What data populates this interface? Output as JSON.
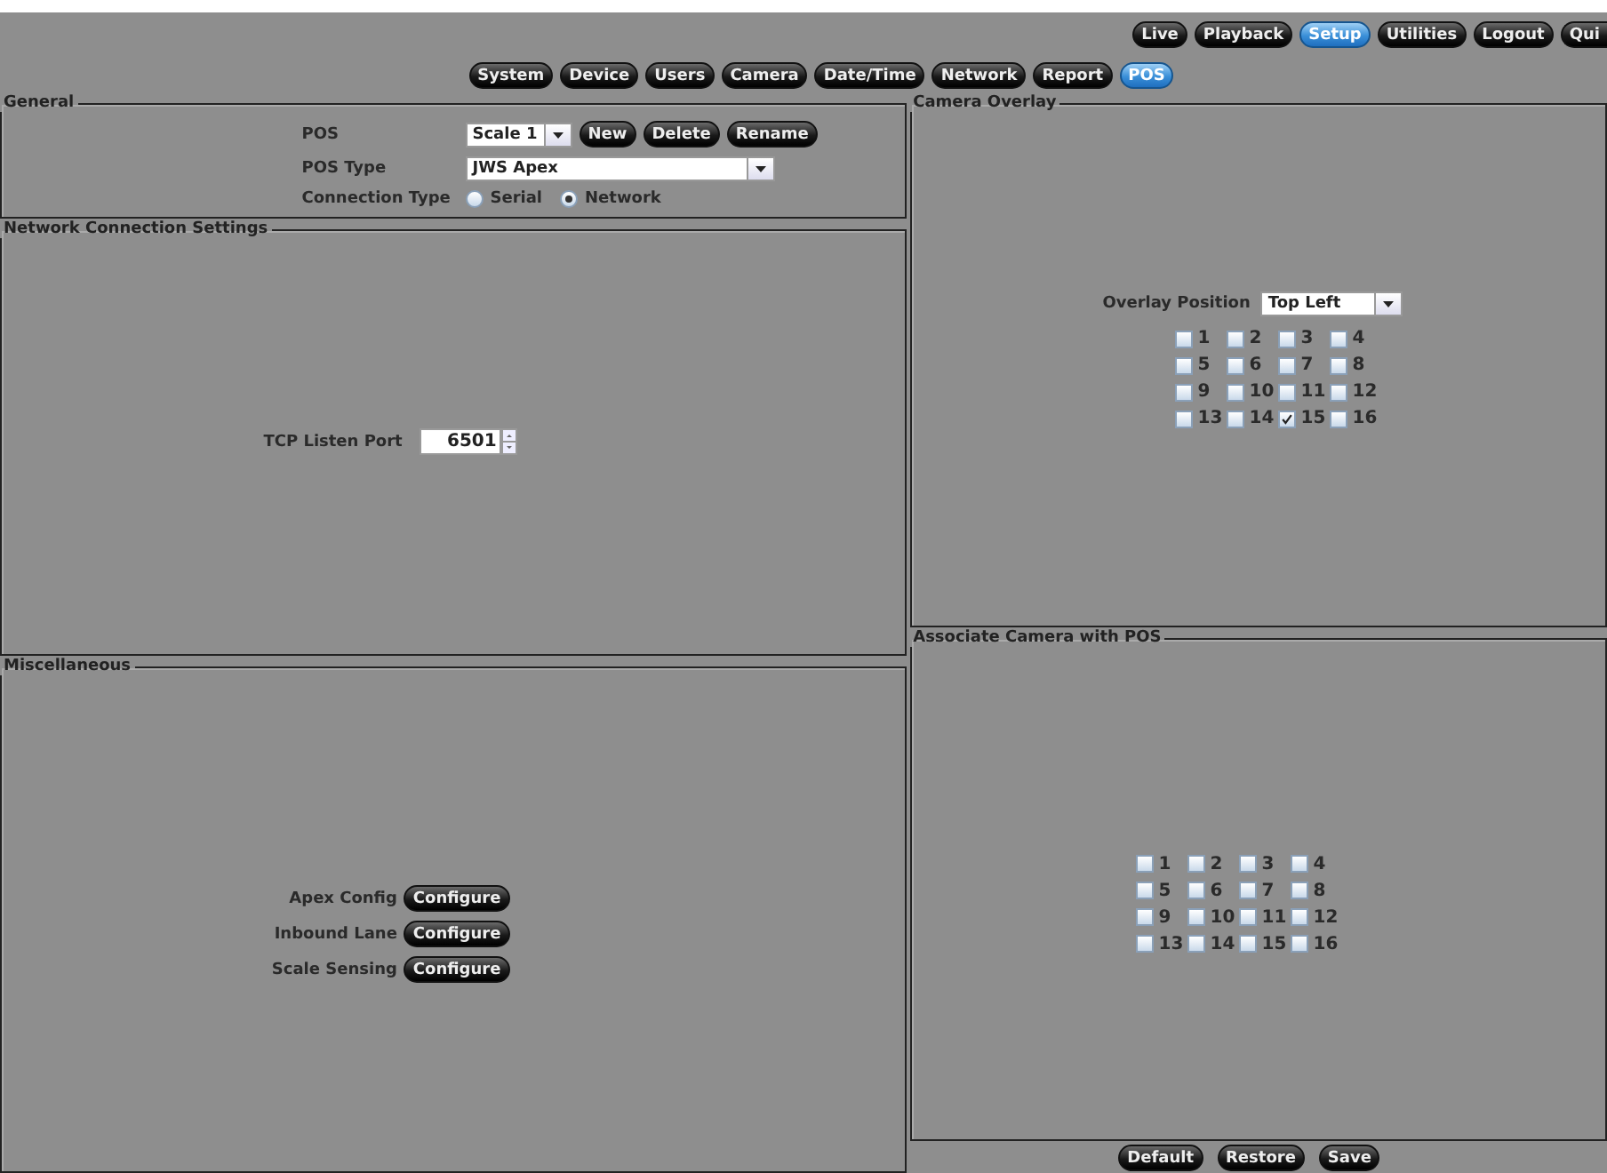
{
  "top_nav": [
    {
      "label": "Live",
      "selected": false
    },
    {
      "label": "Playback",
      "selected": false
    },
    {
      "label": "Setup",
      "selected": true
    },
    {
      "label": "Utilities",
      "selected": false
    },
    {
      "label": "Logout",
      "selected": false
    },
    {
      "label": "Qui",
      "selected": false
    }
  ],
  "setup_tabs": [
    {
      "label": "System",
      "selected": false
    },
    {
      "label": "Device",
      "selected": false
    },
    {
      "label": "Users",
      "selected": false
    },
    {
      "label": "Camera",
      "selected": false
    },
    {
      "label": "Date/Time",
      "selected": false
    },
    {
      "label": "Network",
      "selected": false
    },
    {
      "label": "Report",
      "selected": false
    },
    {
      "label": "POS",
      "selected": true
    }
  ],
  "general": {
    "title": "General",
    "pos_label": "POS",
    "pos_value": "Scale 1",
    "pos_buttons": [
      "New",
      "Delete",
      "Rename"
    ],
    "pos_type_label": "POS Type",
    "pos_type_value": "JWS Apex",
    "connection_label": "Connection Type",
    "connection_options": [
      {
        "label": "Serial",
        "selected": false
      },
      {
        "label": "Network",
        "selected": true
      }
    ]
  },
  "network": {
    "title": "Network Connection Settings",
    "port_label": "TCP Listen Port",
    "port_value": "6501"
  },
  "misc": {
    "title": "Miscellaneous",
    "rows": [
      {
        "label": "Apex Config",
        "button": "Configure"
      },
      {
        "label": "Inbound Lane",
        "button": "Configure"
      },
      {
        "label": "Scale Sensing",
        "button": "Configure"
      }
    ]
  },
  "camera_overlay": {
    "title": "Camera Overlay",
    "position_label": "Overlay Position",
    "position_value": "Top Left",
    "cameras": [
      {
        "label": "1",
        "checked": false
      },
      {
        "label": "2",
        "checked": false
      },
      {
        "label": "3",
        "checked": false
      },
      {
        "label": "4",
        "checked": false
      },
      {
        "label": "5",
        "checked": false
      },
      {
        "label": "6",
        "checked": false
      },
      {
        "label": "7",
        "checked": false
      },
      {
        "label": "8",
        "checked": false
      },
      {
        "label": "9",
        "checked": false
      },
      {
        "label": "10",
        "checked": false
      },
      {
        "label": "11",
        "checked": false
      },
      {
        "label": "12",
        "checked": false
      },
      {
        "label": "13",
        "checked": false
      },
      {
        "label": "14",
        "checked": false
      },
      {
        "label": "15",
        "checked": true
      },
      {
        "label": "16",
        "checked": false
      }
    ]
  },
  "associate": {
    "title": "Associate Camera with POS",
    "cameras": [
      {
        "label": "1",
        "checked": false
      },
      {
        "label": "2",
        "checked": false
      },
      {
        "label": "3",
        "checked": false
      },
      {
        "label": "4",
        "checked": false
      },
      {
        "label": "5",
        "checked": false
      },
      {
        "label": "6",
        "checked": false
      },
      {
        "label": "7",
        "checked": false
      },
      {
        "label": "8",
        "checked": false
      },
      {
        "label": "9",
        "checked": false
      },
      {
        "label": "10",
        "checked": false
      },
      {
        "label": "11",
        "checked": false
      },
      {
        "label": "12",
        "checked": false
      },
      {
        "label": "13",
        "checked": false
      },
      {
        "label": "14",
        "checked": false
      },
      {
        "label": "15",
        "checked": false
      },
      {
        "label": "16",
        "checked": false
      }
    ]
  },
  "buttons": [
    "Default",
    "Restore",
    "Save"
  ]
}
